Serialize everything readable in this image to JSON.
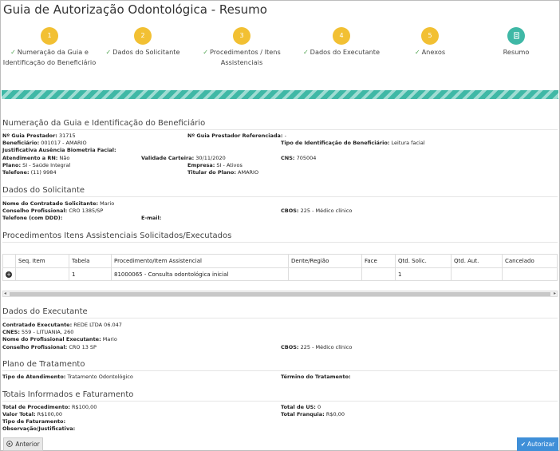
{
  "page_title": "Guia de Autorização Odontológica - Resumo",
  "steps": [
    {
      "num": "1",
      "label": "Numeração da Guia e Identificação do Beneficiário",
      "done": true
    },
    {
      "num": "2",
      "label": "Dados do Solicitante",
      "done": true
    },
    {
      "num": "3",
      "label": "Procedimentos / Itens Assistenciais",
      "done": true
    },
    {
      "num": "4",
      "label": "Dados do Executante",
      "done": true
    },
    {
      "num": "5",
      "label": "Anexos",
      "done": true
    },
    {
      "num": "6",
      "label": "Resumo",
      "done": false
    }
  ],
  "sections": {
    "numeracao": "Numeração da Guia e Identificação do Beneficiário",
    "solicitante": "Dados do Solicitante",
    "procedimentos": "Procedimentos Itens Assistenciais Solicitados/Executados",
    "executante": "Dados do Executante",
    "plano": "Plano de Tratamento",
    "totais": "Totais Informados e Faturamento"
  },
  "numeracao": {
    "guia_prestador_label": "Nº Guia Prestador:",
    "guia_prestador": "31715",
    "guia_referenciada_label": "Nº Guia Prestador Referenciada:",
    "guia_referenciada": "-",
    "beneficiario_label": "Beneficiário:",
    "beneficiario": "001017 - AMARIO",
    "tipo_ident_label": "Tipo de Identificação do Beneficiário:",
    "tipo_ident": "Leitura facial",
    "justificativa_label": "Justificativa Ausência Biometria Facial:",
    "atendimento_rn_label": "Atendimento a RN:",
    "atendimento_rn": "Não",
    "validade_label": "Validade Carteira:",
    "validade": "30/11/2020",
    "cns_label": "CNS:",
    "cns": "705004",
    "plano_label": "Plano:",
    "plano": "SI - Saúde Integral",
    "empresa_label": "Empresa:",
    "empresa": "SI - Ativos",
    "telefone_label": "Telefone:",
    "telefone": "(11) 9984",
    "titular_label": "Titular do Plano:",
    "titular": "AMARIO"
  },
  "solicitante": {
    "nome_label": "Nome do Contratado Solicitante:",
    "nome": "Mario",
    "conselho_label": "Conselho Profissional:",
    "conselho": "CRO 1385/SP",
    "cbos_label": "CBOS:",
    "cbos": "225 - Médico clínico",
    "telefone_label": "Telefone (com DDD):",
    "email_label": "E-mail:"
  },
  "procedimentos": {
    "headers": [
      "",
      "Seq. Item",
      "Tabela",
      "Procedimento/Item Assistencial",
      "Dente/Região",
      "Face",
      "Qtd. Solic.",
      "Qtd. Aut.",
      "Cancelado"
    ],
    "rows": [
      [
        "",
        "",
        "1",
        "81000065 - Consulta odontológica inicial",
        "",
        "",
        "1",
        "",
        ""
      ]
    ]
  },
  "executante": {
    "contratado_label": "Contratado Executante:",
    "contratado": "REDE LTDA 06.047",
    "cnes_label": "CNES:",
    "cnes": "559 - LITUANIA, 260",
    "profissional_label": "Nome do Profissional Executante:",
    "profissional": "Mario",
    "conselho_label": "Conselho Profissional:",
    "conselho": "CRO 13   SP",
    "cbos_label": "CBOS:",
    "cbos": "225 - Médico clínico"
  },
  "plano": {
    "tipo_label": "Tipo de Atendimento:",
    "tipo": "Tratamento Odontológico",
    "termino_label": "Término do Tratamento:"
  },
  "totais": {
    "total_proc_label": "Total de Procedimento:",
    "total_proc": "R$100,00",
    "total_us_label": "Total de US:",
    "total_us": "0",
    "valor_total_label": "Valor Total:",
    "valor_total": "R$100,00",
    "franquia_label": "Total Franquia:",
    "franquia": "R$0,00",
    "tipo_fat_label": "Tipo de Faturamento:",
    "obs_label": "Observação/Justificativa:"
  },
  "buttons": {
    "anterior": "Anterior",
    "autorizar": "Autorizar"
  },
  "colors": {
    "step_pending": "#f2c033",
    "step_active": "#3fb8a6",
    "primary": "#3f8fd8"
  }
}
